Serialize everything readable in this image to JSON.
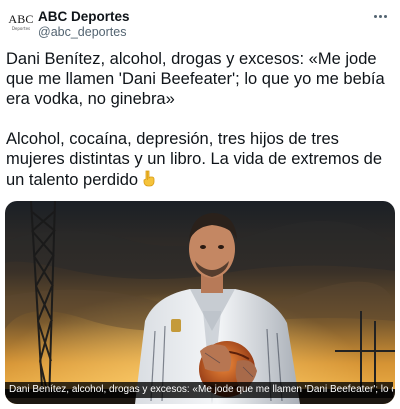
{
  "account": {
    "display_name": "ABC Deportes",
    "handle": "@abc_deportes",
    "avatar_logo": "ABC",
    "avatar_sub": "Deportes"
  },
  "tweet": {
    "paragraph_1": "Dani Benítez, alcohol, drogas y excesos: «Me jode que me llamen 'Dani Beefeater'; lo que yo me bebía era vodka, no ginebra»",
    "paragraph_2": "Alcohol, cocaína, depresión, tres hijos de tres mujeres distintas y un libro. La vida de extremos de un talento perdido",
    "emoji": "👇"
  },
  "media": {
    "caption": "Dani Benítez, alcohol, drogas y excesos: «Me jode que me llamen 'Dani Beefeater'; lo qu..."
  },
  "icons": {
    "more": "more-horizontal-icon",
    "pointing_down": "backhand-index-pointing-down-icon"
  },
  "colors": {
    "text": "#0f1419",
    "secondary": "#536471",
    "sky_glow": "#f2a93b"
  }
}
